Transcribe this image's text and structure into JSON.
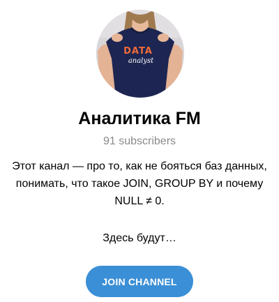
{
  "channel": {
    "title": "Аналитика FM",
    "subscribers": "91 subscribers",
    "description_lines": [
      "Этот канал — про то, как не бояться баз данных,",
      "понимать, что такое JOIN, GROUP BY и почему",
      "NULL ≠ 0."
    ],
    "description_more": "Здесь будут…",
    "avatar": {
      "shirt_text_top": "DATA",
      "shirt_text_bottom": "analyst"
    }
  },
  "actions": {
    "join_label": "JOIN CHANNEL"
  },
  "colors": {
    "accent": "#3b8fd6",
    "muted_text": "#8a8a8a"
  }
}
